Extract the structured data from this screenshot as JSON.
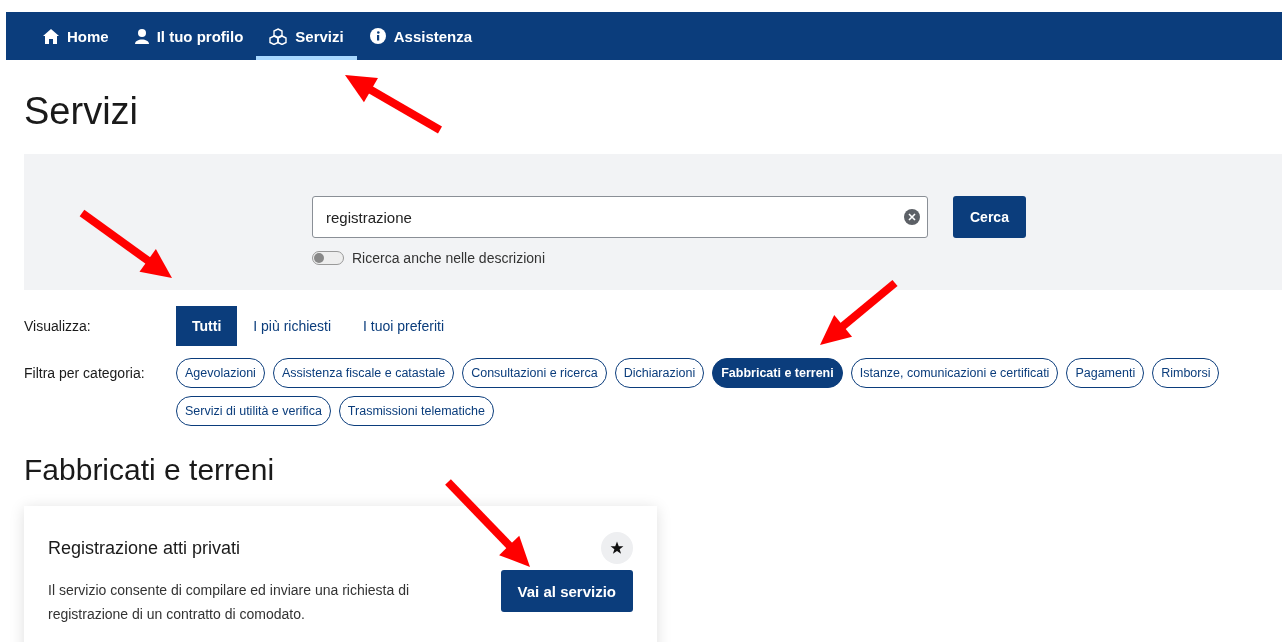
{
  "nav": [
    {
      "label": "Home",
      "selected": false
    },
    {
      "label": "Il tuo profilo",
      "selected": false
    },
    {
      "label": "Servizi",
      "selected": true
    },
    {
      "label": "Assistenza",
      "selected": false
    }
  ],
  "page_title": "Servizi",
  "search": {
    "value": "registrazione",
    "button": "Cerca",
    "toggle": {
      "label": "Ricerca anche nelle descrizioni",
      "on": false
    }
  },
  "view": {
    "label": "Visualizza:",
    "tabs": [
      {
        "label": "Tutti",
        "selected": true
      },
      {
        "label": "I più richiesti",
        "selected": false
      },
      {
        "label": "I tuoi preferiti",
        "selected": false
      }
    ]
  },
  "filter": {
    "label": "Filtra per categoria:",
    "chips": [
      {
        "label": "Agevolazioni",
        "selected": false
      },
      {
        "label": "Assistenza fiscale e catastale",
        "selected": false
      },
      {
        "label": "Consultazioni e ricerca",
        "selected": false
      },
      {
        "label": "Dichiarazioni",
        "selected": false
      },
      {
        "label": "Fabbricati e terreni",
        "selected": true
      },
      {
        "label": "Istanze, comunicazioni e certificati",
        "selected": false
      },
      {
        "label": "Pagamenti",
        "selected": false
      },
      {
        "label": "Rimborsi",
        "selected": false
      },
      {
        "label": "Servizi di utilità e verifica",
        "selected": false
      },
      {
        "label": "Trasmissioni telematiche",
        "selected": false
      }
    ]
  },
  "section_title": "Fabbricati e terreni",
  "cards": [
    {
      "title": "Registrazione atti privati",
      "description": "Il servizio consente di compilare ed inviare una richiesta di registrazione di un contratto di comodato.",
      "button": "Vai al servizio"
    }
  ],
  "annotations": [
    {
      "kind": "arrow"
    },
    {
      "kind": "arrow"
    },
    {
      "kind": "arrow"
    },
    {
      "kind": "arrow"
    }
  ]
}
